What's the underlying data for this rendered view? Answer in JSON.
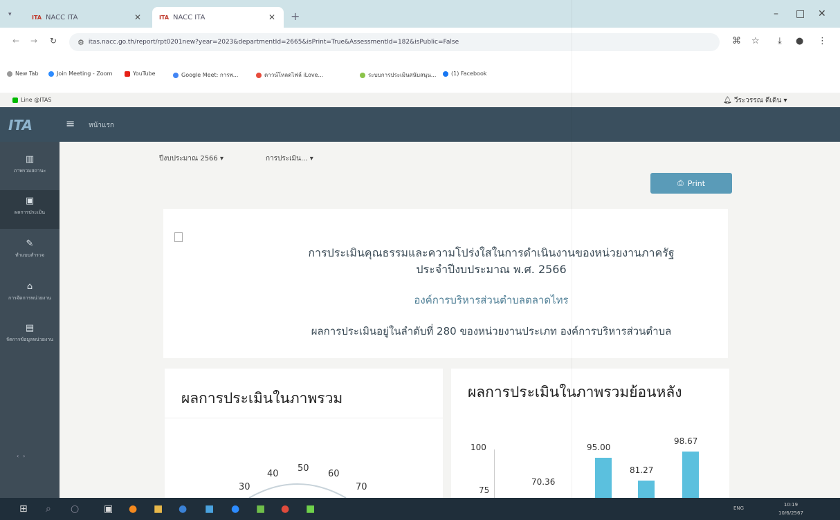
{
  "browser": {
    "tabs": [
      {
        "label": "NACC ITA",
        "active": false
      },
      {
        "label": "NACC ITA",
        "active": true
      }
    ],
    "favicon_text": "ITA",
    "new_tab": "+",
    "window_controls": [
      "–",
      "□",
      "✕"
    ],
    "url": "itas.nacc.go.th/report/rpt0201new?year=2023&departmentId=2665&isPrint=True&AssessmentId=182&isPublic=False",
    "bookmarks": [
      "New Tab",
      "Join Meeting - Zoom",
      "YouTube",
      "Google Meet: การพ...",
      "ดาวน์โหลดไฟล์ iLove...",
      "ระบบการประเมินสนับสนุน...",
      "(1) Facebook"
    ],
    "bookmark_line": "Line @ITAS",
    "user_name": "วีระวรรณ ดีเดิน ▾"
  },
  "app": {
    "logo": "ITA",
    "home_link": "หน้าแรก",
    "sidebar": [
      {
        "icon": "chart-icon",
        "label": "ภาพรวมสถานะ"
      },
      {
        "icon": "report-icon",
        "label": "ผลการประเมิน"
      },
      {
        "icon": "edit-icon",
        "label": "ทำแบบสำรวจ"
      },
      {
        "icon": "home-icon",
        "label": "การจัดการหน่วยงาน"
      },
      {
        "icon": "doc-icon",
        "label": "จัดการข้อมูลหน่วยงาน"
      }
    ],
    "filter_year": "ปีงบประมาณ 2566 ▾",
    "filter_assessment": "การประเมิน... ▾",
    "print_label": "Print",
    "header": {
      "title": "การประเมินคุณธรรมและความโปร่งใสในการดำเนินงานของหน่วยงานภาครัฐ",
      "subtitle": "ประจำปีงบประมาณ พ.ศ. 2566",
      "org": "องค์การบริหารส่วนตำบลตลาดไทร",
      "rank": "ผลการประเมินอยู่ในลำดับที่ 280 ของหน่วยงานประเภท องค์การบริหารส่วนตำบล"
    },
    "overall_title": "ผลการประเมินในภาพรวม",
    "history_title": "ผลการประเมินในภาพรวมย้อนหลัง",
    "gauge_ticks": [
      "30",
      "40",
      "50",
      "60",
      "70"
    ]
  },
  "chart_data": {
    "type": "bar",
    "title": "ผลการประเมินในภาพรวมย้อนหลัง",
    "y_ticks": [
      "100",
      "75"
    ],
    "values": [
      70.36,
      95.0,
      81.27,
      98.67
    ],
    "value_labels": [
      "70.36",
      "95.00",
      "81.27",
      "98.67"
    ],
    "color": "#5bc0de"
  },
  "taskbar": {
    "tray": "ENG",
    "time": "10:19",
    "date": "10/6/2567"
  }
}
